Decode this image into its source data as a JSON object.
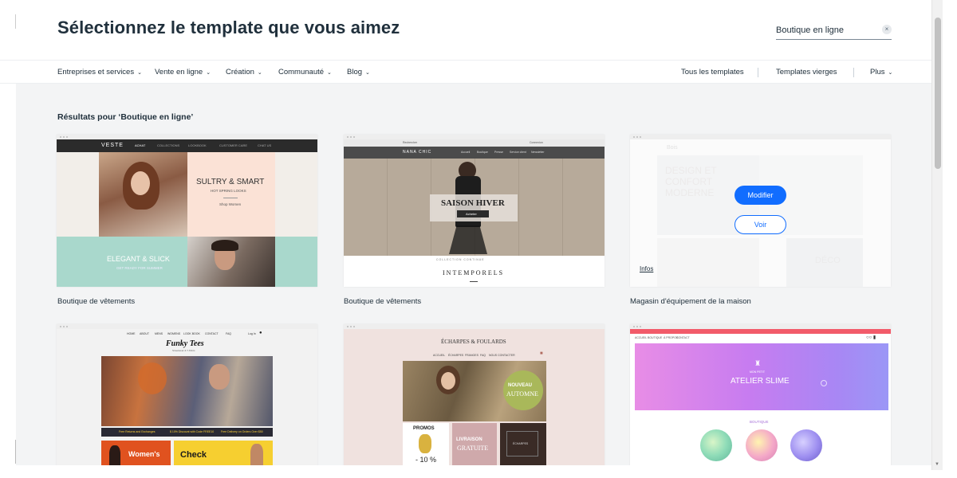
{
  "header": {
    "title": "Sélectionnez le template que vous aimez",
    "search_value": "Boutique en ligne",
    "clear_glyph": "×"
  },
  "nav": {
    "categories": [
      {
        "label": "Entreprises et services"
      },
      {
        "label": "Vente en ligne"
      },
      {
        "label": "Création"
      },
      {
        "label": "Communauté"
      },
      {
        "label": "Blog"
      }
    ],
    "right_links": [
      {
        "label": "Tous les templates"
      },
      {
        "label": "Templates vierges"
      },
      {
        "label": "Plus"
      }
    ],
    "chevron_glyph": "⌄"
  },
  "results": {
    "heading": "Résultats pour ‘Boutique en ligne’"
  },
  "templates": [
    {
      "name": "Boutique de vêtements",
      "preview": {
        "brand": "VESTE",
        "menu": [
          "ACHAT",
          "COLLECTIONS",
          "LOOKBOOK",
          "CUSTOMER CARE",
          "CHAT US"
        ],
        "headline1": "SULTRY & SMART",
        "sub1": "HOT SPRING LOOKS",
        "cta1": "Shop Women",
        "headline2": "ELEGANT & SLICK",
        "sub2": "GET READY FOR SUMMER"
      }
    },
    {
      "name": "Boutique de vêtements",
      "preview": {
        "brand": "NANA CHIC",
        "top_left": "Rechercher",
        "top_right": "Connexion",
        "menu": [
          "Accueil",
          "Boutique",
          "Presse",
          "Service client",
          "Newsletter"
        ],
        "headline": "SAISON HIVER",
        "cta": "Acheter",
        "caption": "COLLECTION CONTINUE",
        "footer_title": "INTEMPORELS"
      }
    },
    {
      "name": "Magasin d'équipement de la maison",
      "modify_label": "Modifier",
      "view_label": "Voir",
      "info_label": "Infos",
      "preview": {
        "brand": "Bois",
        "headline": "DESIGN ET CONFORT MODERNE",
        "tag": "DÉCO"
      }
    },
    {
      "name": "",
      "preview": {
        "brand": "Funky Tees",
        "tagline": "Streetwear & T-Shirts",
        "menu": [
          "HOME",
          "ABOUT",
          "MENS",
          "WOMENS",
          "LOOK BOOK",
          "CONTACT",
          "FAQ"
        ],
        "login": "Log In",
        "promos": [
          "Free Returns and Exchanges",
          "$ 10% Discount with Code FREE10",
          "Free Delivery on Orders Over $50"
        ],
        "tile1": "Women's",
        "tile2": "Check"
      }
    },
    {
      "name": "",
      "preview": {
        "brand": "ÉCHARPES & FOULARDS",
        "menu": [
          "ACCUEIL",
          "ÉCHARPES",
          "FRANGES",
          "FAQ",
          "NOUS CONTACTER"
        ],
        "badge1": "NOUVEAU",
        "badge2": "AUTOMNE",
        "promos_title": "PROMOS",
        "promos_value": "- 10 %",
        "delivery1": "LIVRAISON",
        "delivery2": "GRATUITE",
        "dark_tile": "ÉCHARPES"
      }
    },
    {
      "name": "",
      "preview": {
        "menu": [
          "ACCUEIL",
          "BOUTIQUE",
          "À PROPOS",
          "CONTACT"
        ],
        "small": "MON PETIT",
        "brand": "ATELIER SLIME",
        "section": "BOUTIQUE"
      }
    }
  ],
  "colors": {
    "accent": "#116dff",
    "text": "#20303c",
    "background": "#f3f4f5"
  }
}
